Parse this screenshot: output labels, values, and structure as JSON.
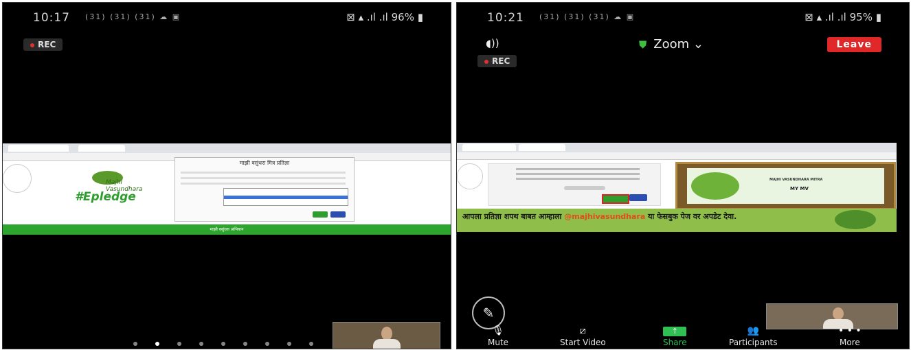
{
  "left_screen": {
    "time": "10:17",
    "status_icons": "(31) (31) (31) ☁ ▣",
    "battery": "96%",
    "rec_label": "REC",
    "shared_page": {
      "heading": "माझी वसुंधरा मित्र प्रतिज्ञा",
      "logo_text": "#Epledge",
      "logo_small": "Majhi Vasundhara",
      "green_bar_text": "माझी वसुंधरा अभियान"
    },
    "pager_count": 9,
    "pager_active": 1
  },
  "right_screen": {
    "time": "10:21",
    "status_icons": "(31) (31) (31) ☁ ▣",
    "battery": "95%",
    "meeting_title": "Zoom",
    "leave_label": "Leave",
    "rec_label": "REC",
    "shared_page": {
      "banner_text": "आपला प्रतिज्ञा शपथ बाबत आम्हाला",
      "banner_handle": "@majhivasundhara",
      "banner_text2": "या फेसबुक पेज वर अपडेट देवा.",
      "certificate_title": "MAJHI VASUNDHARA MITRA",
      "certificate_name": "MY MV"
    },
    "toolbar": [
      {
        "label": "Mute",
        "icon": "microphone-icon"
      },
      {
        "label": "Start Video",
        "icon": "video-off-icon"
      },
      {
        "label": "Share",
        "icon": "share-icon"
      },
      {
        "label": "Participants",
        "icon": "participants-icon"
      },
      {
        "label": "More",
        "icon": "more-icon"
      }
    ]
  },
  "colors": {
    "leave": "#e02828",
    "share": "#2fbf52",
    "rec": "#e03030",
    "shield": "#3fbf3f"
  }
}
